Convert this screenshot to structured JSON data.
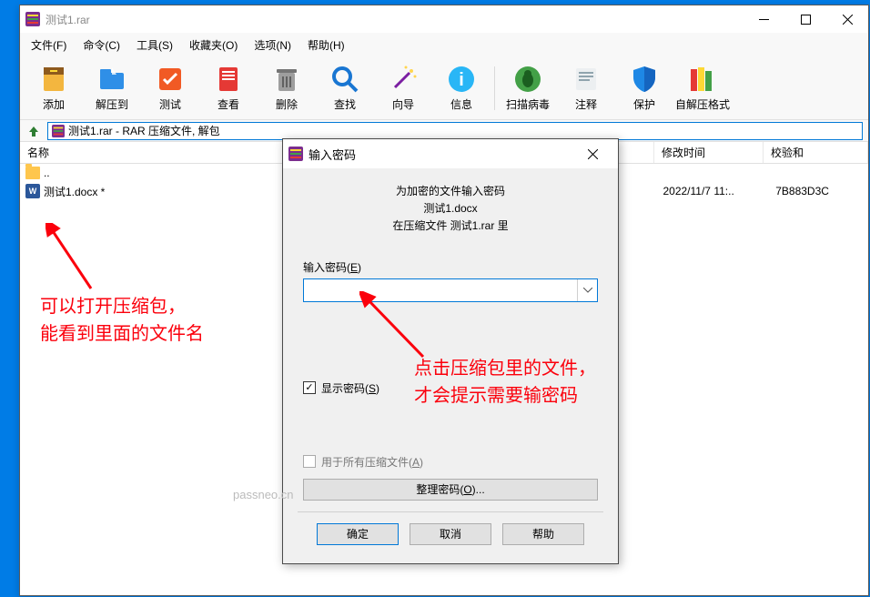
{
  "window": {
    "title": "测试1.rar"
  },
  "menus": [
    "文件(F)",
    "命令(C)",
    "工具(S)",
    "收藏夹(O)",
    "选项(N)",
    "帮助(H)"
  ],
  "toolbar": [
    {
      "label": "添加",
      "name": "add-button"
    },
    {
      "label": "解压到",
      "name": "extract-to-button"
    },
    {
      "label": "测试",
      "name": "test-button"
    },
    {
      "label": "查看",
      "name": "view-button"
    },
    {
      "label": "删除",
      "name": "delete-button"
    },
    {
      "label": "查找",
      "name": "find-button"
    },
    {
      "label": "向导",
      "name": "wizard-button"
    },
    {
      "label": "信息",
      "name": "info-button"
    },
    {
      "sep": true
    },
    {
      "label": "扫描病毒",
      "name": "virus-scan-button"
    },
    {
      "label": "注释",
      "name": "comment-button"
    },
    {
      "label": "保护",
      "name": "protect-button"
    },
    {
      "label": "自解压格式",
      "name": "sfx-button"
    }
  ],
  "path": "测试1.rar - RAR 压缩文件, 解包",
  "columns": {
    "name": "名称",
    "modified": "修改时间",
    "checksum": "校验和"
  },
  "rows": [
    {
      "name": "..",
      "type": "folder",
      "modified": "",
      "checksum": ""
    },
    {
      "name": "测试1.docx *",
      "type": "docx",
      "modified": "2022/11/7 11:..",
      "checksum": "7B883D3C"
    }
  ],
  "dialog": {
    "title": "输入密码",
    "msg_line1": "为加密的文件输入密码",
    "msg_line2": "测试1.docx",
    "msg_line3": "在压缩文件 测试1.rar 里",
    "input_label": "输入密码(E)",
    "show_pwd": "显示密码(S)",
    "all_archives": "用于所有压缩文件(A)",
    "organize": "整理密码(O)...",
    "ok": "确定",
    "cancel": "取消",
    "help": "帮助"
  },
  "annotations": {
    "left_l1": "可以打开压缩包，",
    "left_l2": "能看到里面的文件名",
    "right_l1": "点击压缩包里的文件，",
    "right_l2": "才会提示需要输密码"
  },
  "watermark": "passneo.cn",
  "toolbar_icons": {
    "add-button": {
      "bg": "linear-gradient(#F6D26A,#E79E1E)",
      "inner": "rar"
    },
    "extract-to-button": {
      "bg": "#2F8FE7",
      "inner": "folder"
    },
    "test-button": {
      "bg": "#F15A24",
      "inner": "check"
    },
    "view-button": {
      "bg": "#E53935",
      "inner": "book"
    },
    "delete-button": {
      "bg": "#9E9E9E",
      "inner": "trash"
    },
    "find-button": {
      "bg": "#1976D2",
      "inner": "lens"
    },
    "wizard-button": {
      "bg": "#FFD54F",
      "inner": "wand"
    },
    "info-button": {
      "bg": "#29B6F6",
      "inner": "i"
    },
    "virus-scan-button": {
      "bg": "#43A047",
      "inner": "bug"
    },
    "comment-button": {
      "bg": "#90A4AE",
      "inner": "note"
    },
    "protect-button": {
      "bg": "#1E88E5",
      "inner": "shield"
    },
    "sfx-button": {
      "bg": "linear-gradient(90deg,#E53935,#FDD835,#43A047)",
      "inner": "books"
    }
  }
}
